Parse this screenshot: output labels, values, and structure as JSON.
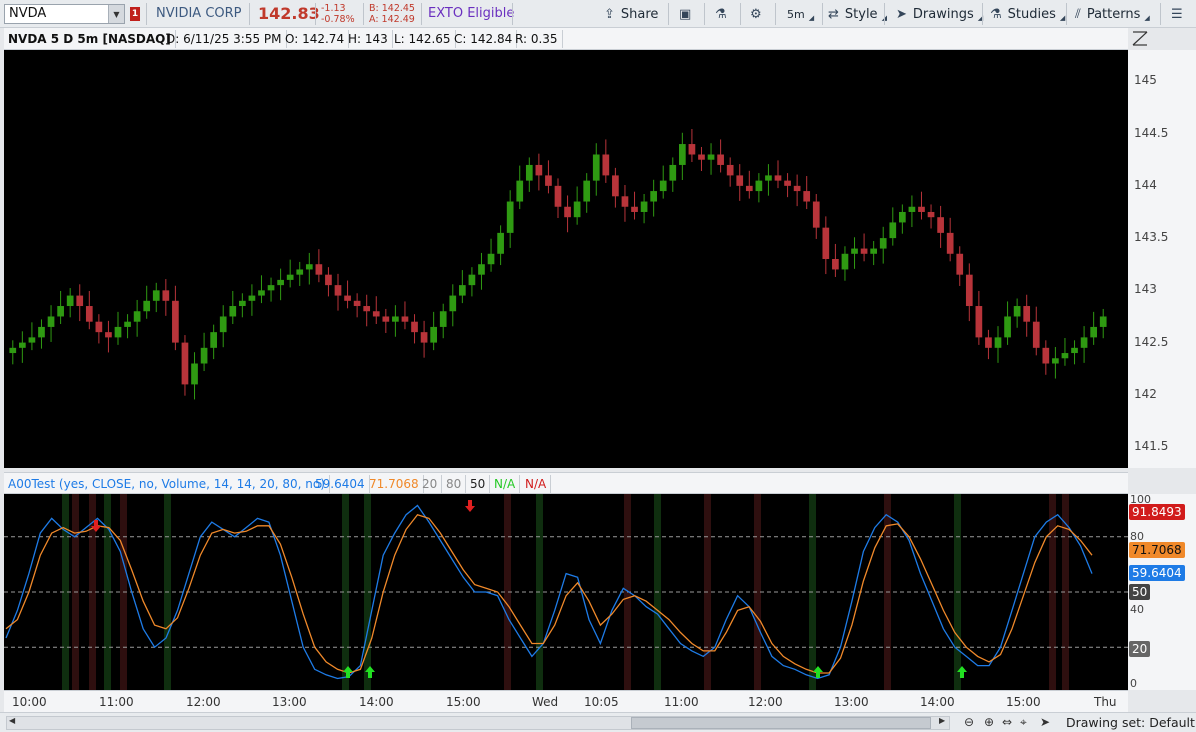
{
  "toolbar": {
    "symbol": "NVDA",
    "alert_badge": "1",
    "company": "NVIDIA CORP",
    "last_price": "142.83",
    "net_change": "-1.13",
    "pct_change": "-0.78%",
    "bid": "B: 142.45",
    "ask": "A: 142.49",
    "exto": "EXTO Eligible",
    "share_label": "Share",
    "timeframe": "5m",
    "style_label": "Style",
    "drawings_label": "Drawings",
    "studies_label": "Studies",
    "patterns_label": "Patterns"
  },
  "chart_header": {
    "symbol_desc": "NVDA 5 D 5m [NASDAQ]",
    "date": "D: 6/11/25 3:55 PM",
    "open": "O: 142.74",
    "high": "H: 143",
    "low": "L: 142.65",
    "close": "C: 142.84",
    "range": "R: 0.35"
  },
  "study_header": {
    "name": "A00Test (yes, CLOSE, no, Volume, 14, 14, 20, 80, no)",
    "v1": "59.6404",
    "v2": "71.7068",
    "v3": "20",
    "v4": "80",
    "v5": "50",
    "v6": "N/A",
    "v7": "N/A"
  },
  "price_axis": [
    "145",
    "144.5",
    "144",
    "143.5",
    "143",
    "142.5",
    "142",
    "141.5"
  ],
  "osc_axis": [
    "100",
    "80",
    "60",
    "40",
    "20",
    "0"
  ],
  "osc_tags": {
    "red": "91.8493",
    "orange": "71.7068",
    "blue": "59.6404",
    "mid": "50",
    "low": "20"
  },
  "time_axis": [
    "10:00",
    "11:00",
    "12:00",
    "13:00",
    "14:00",
    "15:00",
    "Wed",
    "10:05",
    "11:00",
    "12:00",
    "13:00",
    "14:00",
    "15:00",
    "Thu"
  ],
  "bottom": {
    "drawing_set": "Drawing set: Default"
  },
  "colors": {
    "up": "#2f9a12",
    "down": "#b8343a",
    "blue": "#1e7be6",
    "orange": "#f0892a"
  },
  "chart_data": [
    {
      "type": "candlestick",
      "title": "NVDA 5 D 5m [NASDAQ]",
      "ylim": [
        141.3,
        145.3
      ],
      "x_ticks": [
        "10:00",
        "11:00",
        "12:00",
        "13:00",
        "14:00",
        "15:00",
        "Wed",
        "10:05",
        "11:00",
        "12:00",
        "13:00",
        "14:00",
        "15:00",
        "Thu"
      ],
      "close": [
        142.45,
        142.5,
        142.55,
        142.65,
        142.75,
        142.85,
        142.95,
        142.85,
        142.7,
        142.6,
        142.55,
        142.65,
        142.7,
        142.8,
        142.9,
        143.0,
        142.9,
        142.5,
        142.1,
        142.3,
        142.45,
        142.6,
        142.75,
        142.85,
        142.9,
        142.95,
        143.0,
        143.05,
        143.1,
        143.15,
        143.2,
        143.25,
        143.15,
        143.05,
        142.95,
        142.9,
        142.85,
        142.8,
        142.75,
        142.7,
        142.75,
        142.7,
        142.6,
        142.5,
        142.65,
        142.8,
        142.95,
        143.05,
        143.15,
        143.25,
        143.35,
        143.55,
        143.85,
        144.05,
        144.2,
        144.1,
        144.0,
        143.8,
        143.7,
        143.85,
        144.05,
        144.3,
        144.1,
        143.9,
        143.8,
        143.75,
        143.85,
        143.95,
        144.05,
        144.2,
        144.4,
        144.3,
        144.25,
        144.3,
        144.2,
        144.1,
        144.0,
        143.95,
        144.05,
        144.1,
        144.05,
        144.0,
        143.95,
        143.85,
        143.6,
        143.3,
        143.2,
        143.35,
        143.4,
        143.35,
        143.4,
        143.5,
        143.65,
        143.75,
        143.8,
        143.75,
        143.7,
        143.55,
        143.35,
        143.15,
        142.85,
        142.55,
        142.45,
        142.55,
        142.75,
        142.85,
        142.7,
        142.45,
        142.3,
        142.35,
        142.4,
        142.45,
        142.55,
        142.65,
        142.75
      ],
      "open": [
        142.4,
        142.45,
        142.5,
        142.55,
        142.65,
        142.75,
        142.85,
        142.95,
        142.85,
        142.7,
        142.6,
        142.55,
        142.65,
        142.7,
        142.8,
        142.9,
        143.0,
        142.9,
        142.5,
        142.1,
        142.3,
        142.45,
        142.6,
        142.75,
        142.85,
        142.9,
        142.95,
        143.0,
        143.05,
        143.1,
        143.15,
        143.2,
        143.25,
        143.15,
        143.05,
        142.95,
        142.9,
        142.85,
        142.8,
        142.75,
        142.7,
        142.75,
        142.7,
        142.6,
        142.5,
        142.65,
        142.8,
        142.95,
        143.05,
        143.15,
        143.25,
        143.35,
        143.55,
        143.85,
        144.05,
        144.2,
        144.1,
        144.0,
        143.8,
        143.7,
        143.85,
        144.05,
        144.3,
        144.1,
        143.9,
        143.8,
        143.75,
        143.85,
        143.95,
        144.05,
        144.2,
        144.4,
        144.3,
        144.25,
        144.3,
        144.2,
        144.1,
        144.0,
        143.95,
        144.05,
        144.1,
        144.05,
        144.0,
        143.95,
        143.85,
        143.6,
        143.3,
        143.2,
        143.35,
        143.4,
        143.35,
        143.4,
        143.5,
        143.65,
        143.75,
        143.8,
        143.75,
        143.7,
        143.55,
        143.35,
        143.15,
        142.85,
        142.55,
        142.45,
        142.55,
        142.75,
        142.85,
        142.7,
        142.45,
        142.3,
        142.35,
        142.4,
        142.45,
        142.55,
        142.65
      ],
      "high_offset": 0.12,
      "low_offset": 0.12
    },
    {
      "type": "line",
      "title": "A00Test (yes, CLOSE, no, Volume, 14, 14, 20, 80, no)",
      "ylim": [
        0,
        100
      ],
      "reference_lines": [
        20,
        50,
        80
      ],
      "series": [
        {
          "name": "blue",
          "values": [
            25,
            40,
            60,
            82,
            90,
            84,
            80,
            85,
            90,
            84,
            72,
            50,
            30,
            20,
            25,
            40,
            60,
            80,
            88,
            84,
            80,
            85,
            90,
            88,
            70,
            45,
            20,
            8,
            5,
            3,
            4,
            10,
            40,
            70,
            82,
            92,
            97,
            88,
            78,
            68,
            58,
            50,
            50,
            48,
            35,
            25,
            15,
            22,
            40,
            60,
            58,
            35,
            22,
            40,
            52,
            48,
            42,
            38,
            30,
            22,
            18,
            15,
            20,
            35,
            48,
            42,
            28,
            15,
            10,
            8,
            5,
            3,
            5,
            20,
            45,
            72,
            85,
            92,
            88,
            78,
            60,
            45,
            30,
            20,
            15,
            10,
            10,
            20,
            40,
            60,
            80,
            88,
            92,
            85,
            75,
            60
          ]
        },
        {
          "name": "orange",
          "values": [
            30,
            35,
            50,
            70,
            82,
            85,
            82,
            83,
            86,
            85,
            78,
            62,
            45,
            32,
            30,
            36,
            52,
            70,
            82,
            84,
            82,
            83,
            86,
            86,
            76,
            58,
            38,
            20,
            12,
            8,
            6,
            8,
            25,
            50,
            70,
            84,
            92,
            90,
            82,
            72,
            62,
            54,
            52,
            50,
            42,
            32,
            22,
            22,
            32,
            48,
            55,
            45,
            32,
            38,
            46,
            48,
            45,
            40,
            35,
            28,
            22,
            18,
            18,
            28,
            40,
            42,
            34,
            22,
            15,
            11,
            8,
            6,
            6,
            14,
            32,
            56,
            74,
            86,
            87,
            80,
            68,
            54,
            40,
            28,
            20,
            15,
            12,
            16,
            30,
            48,
            66,
            80,
            86,
            84,
            78,
            70
          ]
        }
      ]
    }
  ]
}
